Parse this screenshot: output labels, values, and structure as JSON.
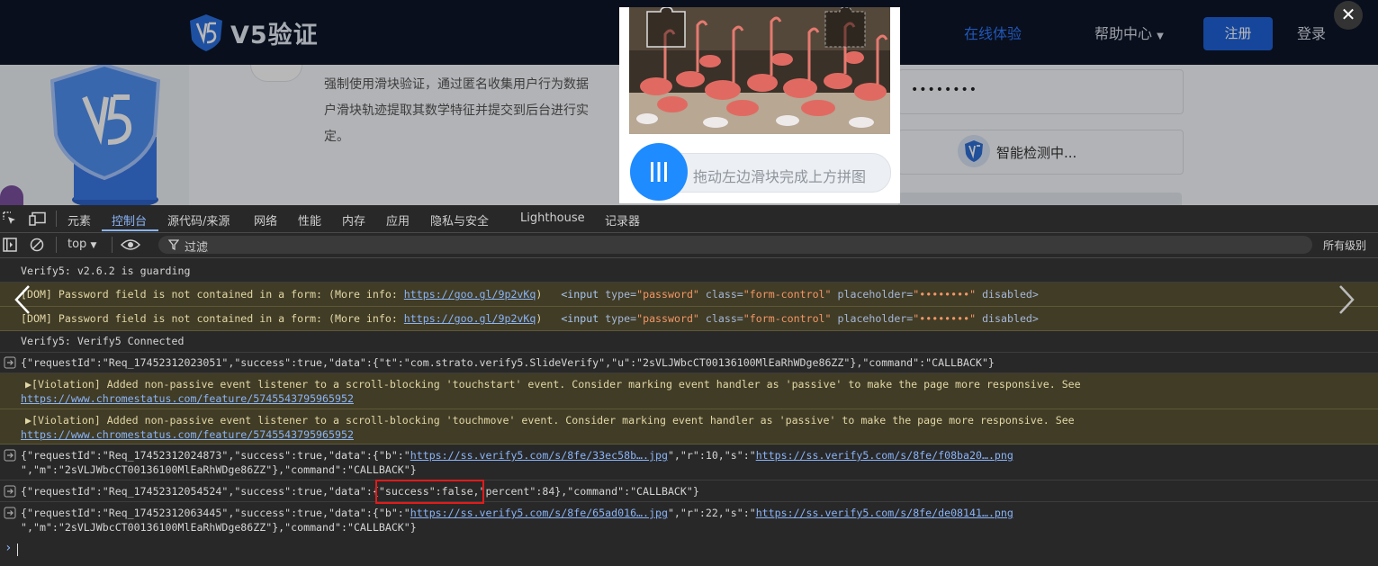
{
  "site": {
    "logo_text": "V5验证",
    "nav": {
      "online": "在线体验",
      "help": "帮助中心",
      "register": "注册",
      "login": "登录"
    },
    "description": "强制使用滑块验证，通过匿名收集用户行为数据户滑块轨迹提取其数学特征并提交到后台进行实定。",
    "desc_lines": [
      "强制使用滑块验证，通过匿名收集用户行为数据",
      "户滑块轨迹提取其数学特征并提交到后台进行实",
      "定。"
    ],
    "password_mask": "••••••••",
    "detecting": "智能检测中..."
  },
  "captcha": {
    "slider_hint": "拖动左边滑块完成上方拼图"
  },
  "devtools": {
    "tabs": [
      "元素",
      "控制台",
      "源代码/来源",
      "网络",
      "性能",
      "内存",
      "应用",
      "隐私与安全",
      "Lighthouse",
      "记录器"
    ],
    "active_tab": "控制台",
    "context": "top",
    "filter_placeholder": "过滤",
    "levels": "所有级别",
    "logs": {
      "l1": "Verify5: v2.6.2 is guarding",
      "l2_text": "[DOM] Password field is not contained in a form: (More info: ",
      "l2_link": "https://goo.gl/9p2vKq",
      "l2_close": ")",
      "l2_tag_open": "<input ",
      "l2_attr1": "type=",
      "l2_val1": "\"password\"",
      "l2_attr2": " class=",
      "l2_val2": "\"form-control\"",
      "l2_attr3": " placeholder=",
      "l2_val3": "\"••••••••\"",
      "l2_attr4": " disabled>",
      "l4": "Verify5: Verify5 Connected",
      "l5": "{\"requestId\":\"Req_17452312023051\",\"success\":true,\"data\":{\"t\":\"com.strato.verify5.SlideVerify\",\"u\":\"2sVLJWbcCT00136100MlEaRhWDge86ZZ\"},\"command\":\"CALLBACK\"}",
      "l6_text": "▶[Violation] Added non-passive event listener to a scroll-blocking 'touchstart' event. Consider marking event handler as 'passive' to make the page more responsive. See",
      "l7_text": "▶[Violation] Added non-passive event listener to a scroll-blocking 'touchmove' event. Consider marking event handler as 'passive' to make the page more responsive. See",
      "violation_link": "https://www.chromestatus.com/feature/5745543795965952",
      "l8_a": "{\"requestId\":\"Req_17452312024873\",\"success\":true,\"data\":{\"b\":\"",
      "l8_link1": "https://ss.verify5.com/s/8fe/33ec58b….jpg",
      "l8_b": "\",\"r\":10,\"s\":\"",
      "l8_link2": "https://ss.verify5.com/s/8fe/f08ba20….png",
      "l8_c": "\",\"m\":\"2sVLJWbcCT00136100MlEaRhWDge86ZZ\"},\"command\":\"CALLBACK\"}",
      "l9": "{\"requestId\":\"Req_17452312054524\",\"success\":true,\"data\":{\"success\":false,\"percent\":84},\"command\":\"CALLBACK\"}",
      "l10_a": "{\"requestId\":\"Req_17452312063445\",\"success\":true,\"data\":{\"b\":\"",
      "l10_link1": "https://ss.verify5.com/s/8fe/65ad016….jpg",
      "l10_b": "\",\"r\":22,\"s\":\"",
      "l10_link2": "https://ss.verify5.com/s/8fe/de08141….png",
      "l10_c": "\",\"m\":\"2sVLJWbcCT00136100MlEaRhWDge86ZZ\"},\"command\":\"CALLBACK\"}"
    }
  },
  "colors": {
    "accent": "#8ab4f8",
    "highlight": "#e01b1b",
    "brand": "#1e62d8"
  }
}
